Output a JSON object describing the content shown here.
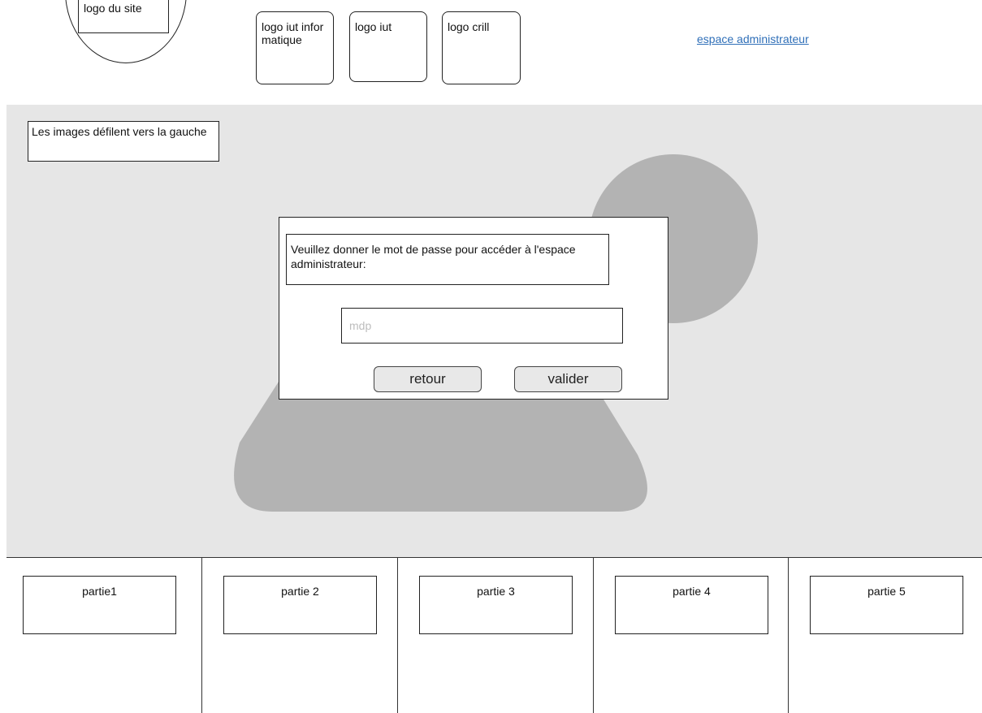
{
  "header": {
    "site_logo": "logo du site",
    "logos": [
      "logo iut informatique",
      "logo iut",
      "logo crill"
    ],
    "admin_link": "espace administrateur"
  },
  "carousel": {
    "note": "Les images défilent vers la gauche"
  },
  "dialog": {
    "message": "Veuillez donner le mot de passe pour accéder à l'espace administrateur:",
    "password_placeholder": "mdp",
    "back_label": "retour",
    "submit_label": "valider"
  },
  "footer": {
    "parts": [
      "partie1",
      "partie 2",
      "partie 3",
      "partie 4",
      "partie 5"
    ]
  },
  "colors": {
    "carousel_bg": "#e6e6e6",
    "shape": "#b3b3b3",
    "link": "#2f6fb8",
    "button_bg": "#e8e8e8"
  }
}
